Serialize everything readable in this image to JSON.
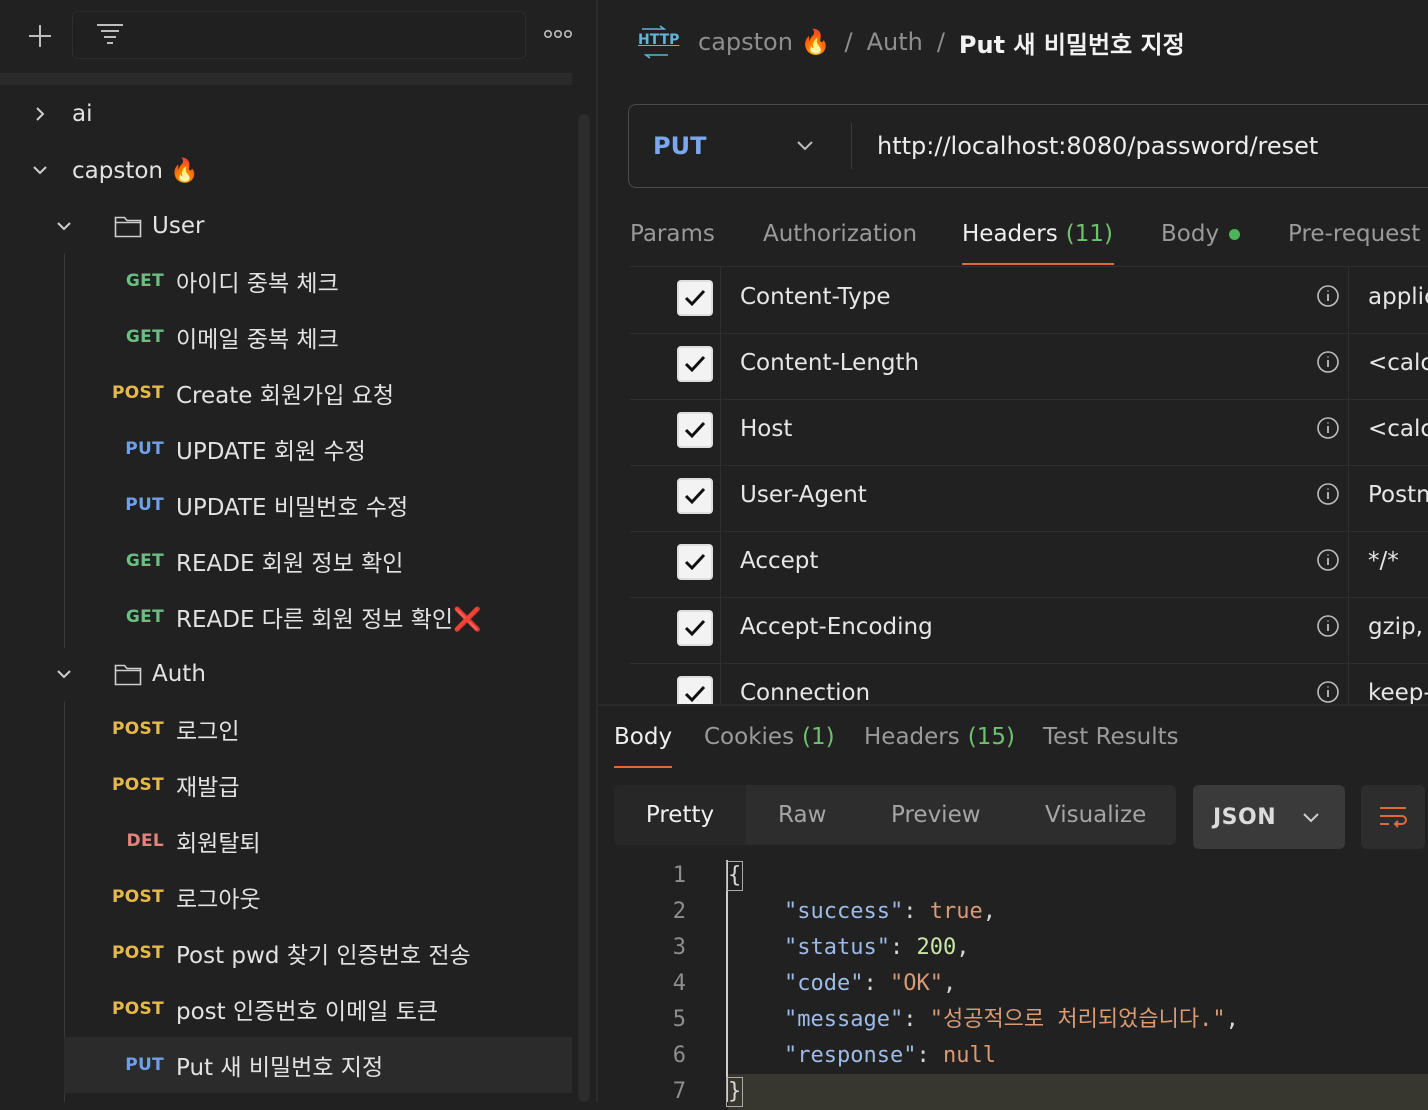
{
  "sidebar": {
    "tree": [
      {
        "label": "ai",
        "expanded": false
      },
      {
        "label": "capston 🔥",
        "expanded": true
      },
      {
        "label": "User",
        "expanded": true
      },
      {
        "label": "Auth",
        "expanded": true
      }
    ],
    "user_requests": [
      {
        "method": "GET",
        "name": "아이디 중복 체크"
      },
      {
        "method": "GET",
        "name": "이메일 중복 체크"
      },
      {
        "method": "POST",
        "name": "Create 회원가입 요청"
      },
      {
        "method": "PUT",
        "name": "UPDATE 회원 수정"
      },
      {
        "method": "PUT",
        "name": "UPDATE 비밀번호 수정"
      },
      {
        "method": "GET",
        "name": "READE 회원 정보 확인"
      },
      {
        "method": "GET",
        "name": "READE 다른 회원 정보 확인❌"
      }
    ],
    "auth_requests": [
      {
        "method": "POST",
        "name": "로그인"
      },
      {
        "method": "POST",
        "name": "재발급"
      },
      {
        "method": "DEL",
        "name": "회원탈퇴"
      },
      {
        "method": "POST",
        "name": "로그아웃"
      },
      {
        "method": "POST",
        "name": "Post pwd 찾기 인증번호 전송"
      },
      {
        "method": "POST",
        "name": "post 인증번호 이메일 토큰"
      },
      {
        "method": "PUT",
        "name": "Put 새 비밀번호 지정"
      }
    ]
  },
  "breadcrumb": {
    "icon_text": "HTTP",
    "collection": "capston 🔥",
    "folder": "Auth",
    "request": "Put 새 비밀번호 지정"
  },
  "request": {
    "method": "PUT",
    "url": "http://localhost:8080/password/reset"
  },
  "tabs": [
    {
      "label": "Params"
    },
    {
      "label": "Authorization"
    },
    {
      "label": "Headers",
      "count": "(11)"
    },
    {
      "label": "Body"
    },
    {
      "label": "Pre-request"
    }
  ],
  "headers": [
    {
      "key": "Content-Type",
      "value": "applic"
    },
    {
      "key": "Content-Length",
      "value": "<calc"
    },
    {
      "key": "Host",
      "value": "<calc"
    },
    {
      "key": "User-Agent",
      "value": "Postm"
    },
    {
      "key": "Accept",
      "value": "*/*"
    },
    {
      "key": "Accept-Encoding",
      "value": "gzip,"
    },
    {
      "key": "Connection",
      "value": "keep-"
    }
  ],
  "response_tabs": [
    {
      "label": "Body"
    },
    {
      "label": "Cookies",
      "count": "(1)"
    },
    {
      "label": "Headers",
      "count": "(15)"
    },
    {
      "label": "Test Results"
    }
  ],
  "view_modes": [
    "Pretty",
    "Raw",
    "Preview",
    "Visualize"
  ],
  "format": "JSON",
  "response_body": {
    "line_numbers": [
      "1",
      "2",
      "3",
      "4",
      "5",
      "6",
      "7"
    ],
    "open": "{",
    "close": "}",
    "lines": [
      {
        "key": "\"success\"",
        "value": "true",
        "type": "b",
        "trail": ","
      },
      {
        "key": "\"status\"",
        "value": "200",
        "type": "n",
        "trail": ","
      },
      {
        "key": "\"code\"",
        "value": "\"OK\"",
        "type": "s",
        "trail": ","
      },
      {
        "key": "\"message\"",
        "value": "\"성공적으로 처리되었습니다.\"",
        "type": "s",
        "trail": ","
      },
      {
        "key": "\"response\"",
        "value": "null",
        "type": "b",
        "trail": ""
      }
    ]
  },
  "colors": {
    "accent": "#e0693a",
    "get": "#6bbf82",
    "post": "#e6b94c",
    "put": "#6e9fe8",
    "del": "#e3837b"
  }
}
